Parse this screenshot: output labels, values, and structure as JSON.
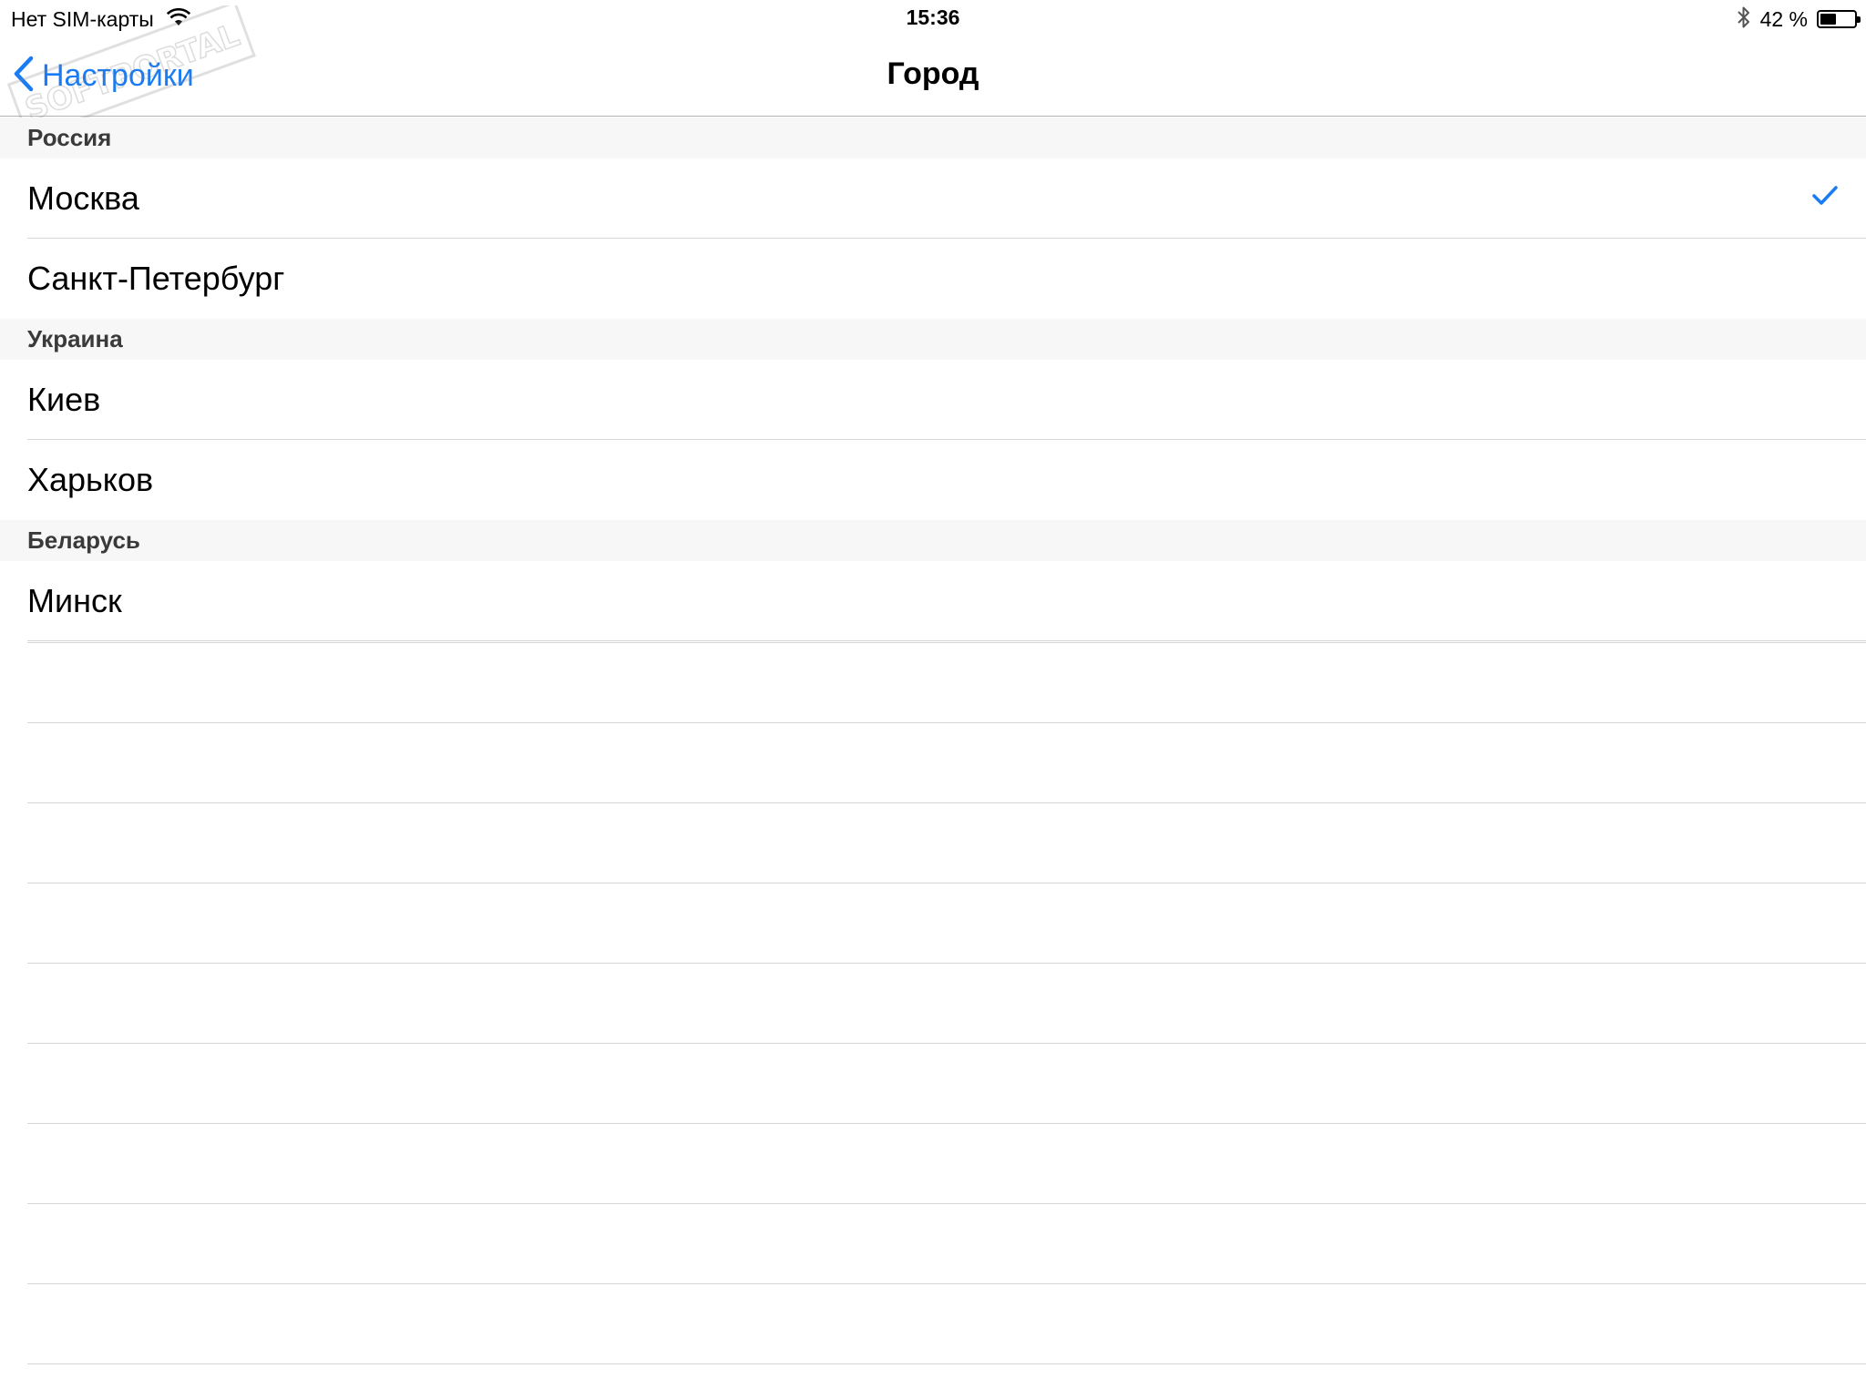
{
  "status_bar": {
    "carrier": "Нет SIM-карты",
    "time": "15:36",
    "battery_text": "42 %",
    "battery_level": 0.42,
    "icons": [
      "wifi-icon",
      "bluetooth-icon",
      "battery-icon"
    ]
  },
  "nav": {
    "back_label": "Настройки",
    "title": "Город"
  },
  "colors": {
    "accent": "#1a7cf4",
    "section_bg": "#f7f7f7",
    "separator": "#d6d6d6"
  },
  "sections": [
    {
      "header": "Россия",
      "rows": [
        {
          "label": "Москва",
          "selected": true
        },
        {
          "label": "Санкт-Петербург",
          "selected": false
        }
      ]
    },
    {
      "header": "Украина",
      "rows": [
        {
          "label": "Киев",
          "selected": false
        },
        {
          "label": "Харьков",
          "selected": false
        }
      ]
    },
    {
      "header": "Беларусь",
      "rows": [
        {
          "label": "Минск",
          "selected": false
        }
      ]
    }
  ],
  "watermark": "SOFTPORTAL"
}
